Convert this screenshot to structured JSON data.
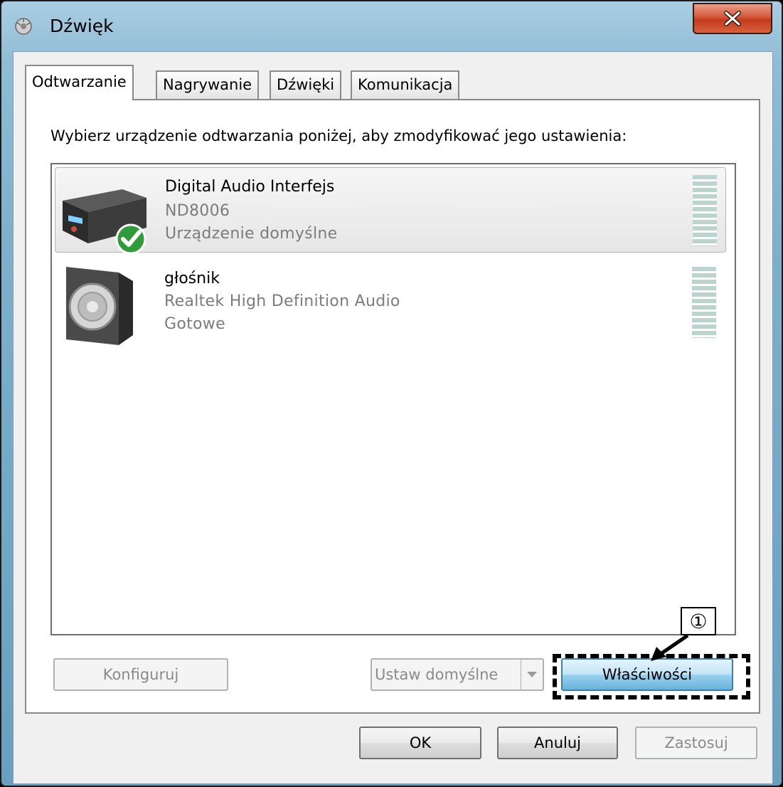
{
  "window": {
    "title": "Dźwięk",
    "close_label": "X"
  },
  "tabs": [
    {
      "label": "Odtwarzanie",
      "active": true
    },
    {
      "label": "Nagrywanie",
      "active": false
    },
    {
      "label": "Dźwięki",
      "active": false
    },
    {
      "label": "Komunikacja",
      "active": false
    }
  ],
  "panel": {
    "prompt": "Wybierz urządzenie odtwarzania poniżej, aby zmodyfikować jego ustawienia:"
  },
  "devices": [
    {
      "name": "Digital Audio Interfejs",
      "detail": "ND8006",
      "status": "Urządzenie domyślne",
      "selected": true,
      "icon": "receiver-icon"
    },
    {
      "name": "głośnik",
      "detail": "Realtek High Definition Audio",
      "status": "Gotowe",
      "selected": false,
      "icon": "speaker-icon"
    }
  ],
  "buttons": {
    "configure": "Konfiguruj",
    "set_default": "Ustaw domyślne",
    "properties": "Właściwości",
    "ok": "OK",
    "cancel": "Anuluj",
    "apply": "Zastosuj"
  },
  "annotation": {
    "callout": "①"
  },
  "colors": {
    "frame": "#7eb0cc",
    "close": "#c23a1d",
    "accent": "#68b3db",
    "meter": "#bcd4cf"
  }
}
